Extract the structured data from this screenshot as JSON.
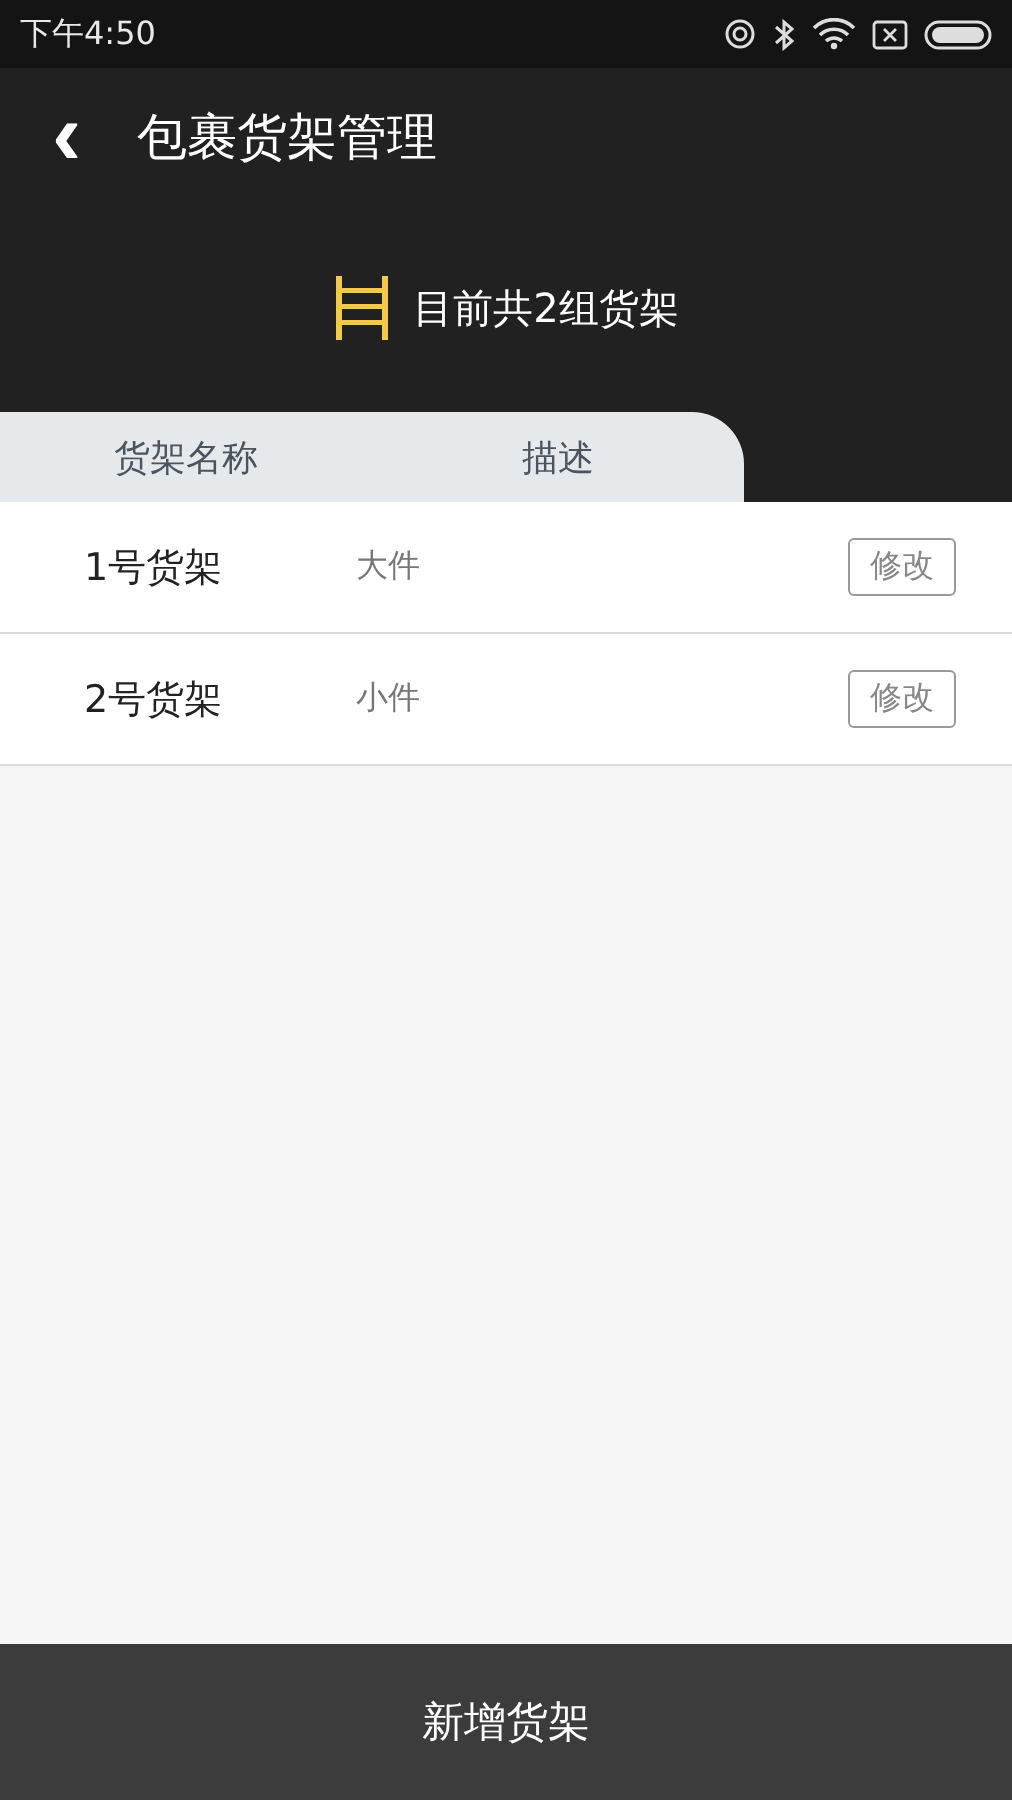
{
  "status_bar": {
    "time": "下午4:50"
  },
  "header": {
    "back": "‹",
    "title": "包裹货架管理"
  },
  "summary": {
    "text": "目前共2组货架"
  },
  "table": {
    "columns": [
      "货架名称",
      "描述"
    ],
    "rows": [
      {
        "name": "1号货架",
        "description": "大件",
        "action": "修改"
      },
      {
        "name": "2号货架",
        "description": "小件",
        "action": "修改"
      }
    ]
  },
  "footer_button": "新增货架"
}
